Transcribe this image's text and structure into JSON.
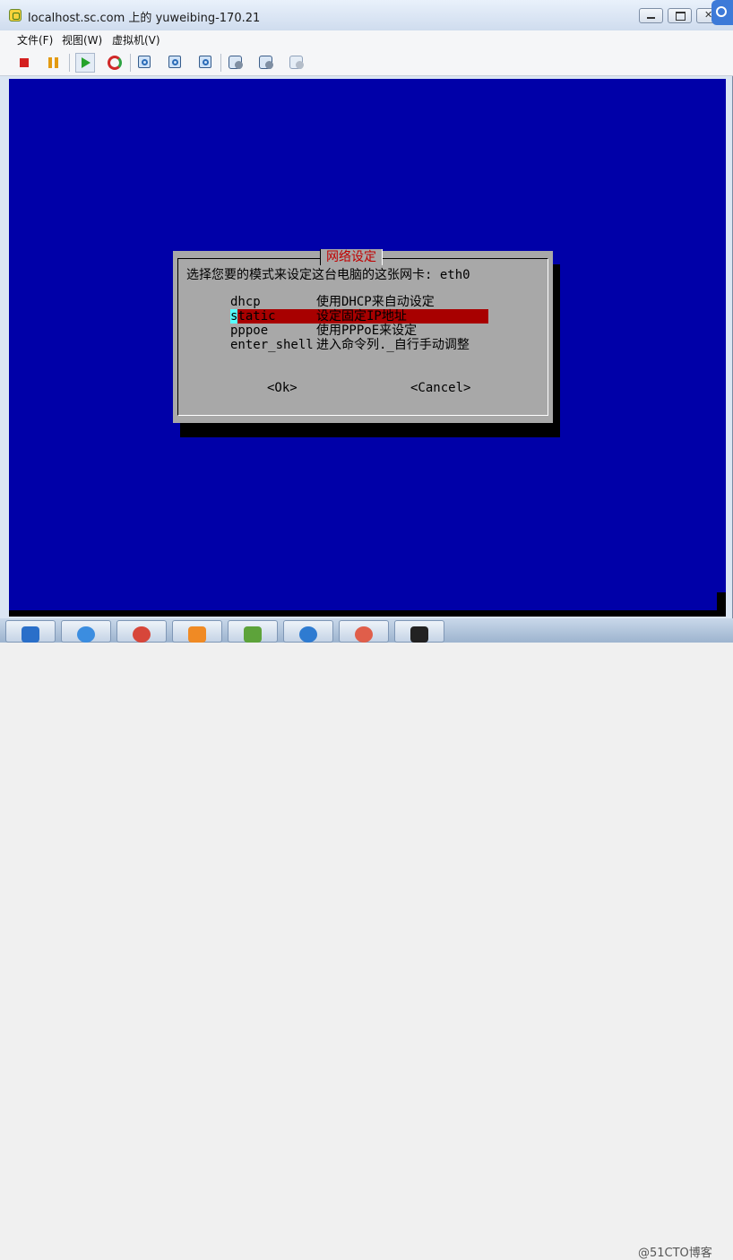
{
  "window": {
    "title": "localhost.sc.com 上的 yuweibing-170.21",
    "icon": "vsphere-vm-icon"
  },
  "menubar": {
    "file": "文件(F)",
    "view": "视图(W)",
    "vm": "虚拟机(V)"
  },
  "toolbar": {
    "items": [
      "stop-icon",
      "pause-icon",
      "play-icon",
      "reset-icon",
      "snapshot-take-icon",
      "snapshot-revert-icon",
      "snapshot-manager-icon",
      "vm-settings-icon",
      "connect-device-icon",
      "disconnect-device-icon"
    ]
  },
  "dialog": {
    "title": "网络设定",
    "prompt": "选择您要的模式来设定这台电脑的这张网卡: eth0",
    "options": [
      {
        "key": "dhcp",
        "desc": "使用DHCP来自动设定"
      },
      {
        "key": "static",
        "desc": "设定固定IP地址"
      },
      {
        "key": "pppoe",
        "desc": "使用PPPoE来设定"
      },
      {
        "key": "enter_shell",
        "desc": "进入命令列._自行手动调整"
      }
    ],
    "selected_index": 1,
    "ok": "<Ok>",
    "cancel": "<Cancel>"
  },
  "colors": {
    "console_bg": "#0000a8",
    "dialog_bg": "#a8a8a8",
    "highlight": "#a80000",
    "title_text": "#c00000"
  },
  "watermark": "@51CTO博客"
}
